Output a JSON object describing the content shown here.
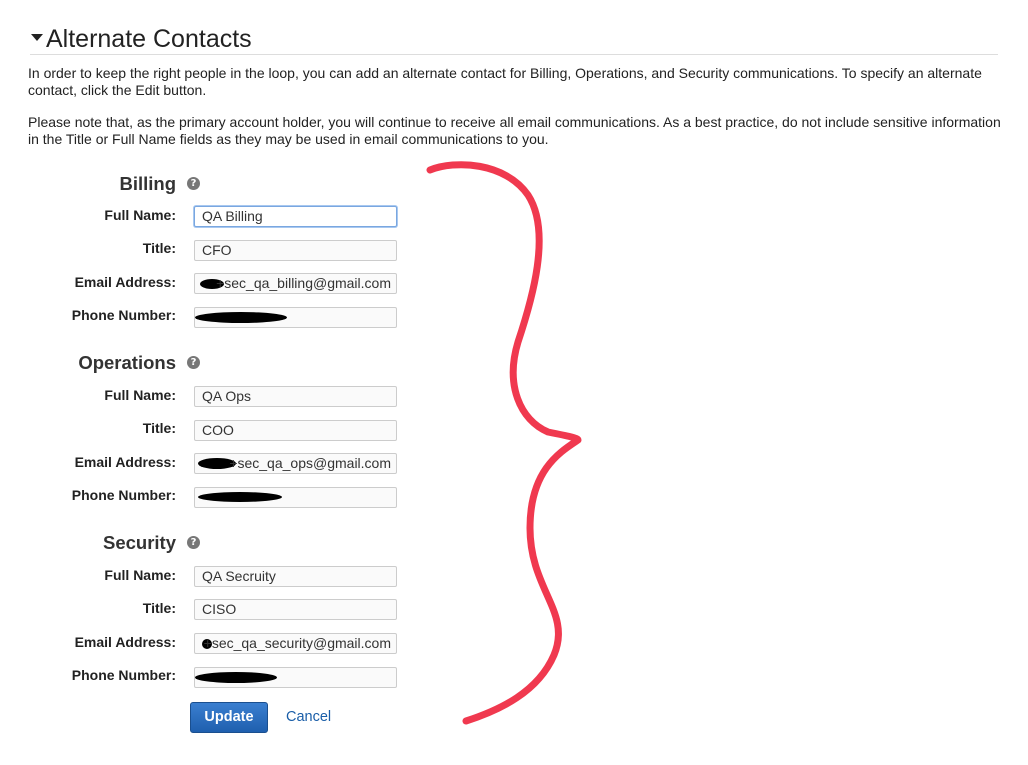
{
  "section": {
    "title": "Alternate Contacts",
    "intro_1": "In order to keep the right people in the loop, you can add an alternate contact for Billing, Operations, and Security communications. To specify an alternate contact, click the Edit button.",
    "intro_2": "Please note that, as the primary account holder, you will continue to receive all email communications. As a best practice, do not include sensitive information in the Title or Full Name fields as they may be used in email communications to you."
  },
  "labels": {
    "full_name": "Full Name:",
    "title": "Title:",
    "email": "Email Address:",
    "phone": "Phone Number:"
  },
  "help_glyph": "?",
  "billing": {
    "heading": "Billing",
    "full_name": "QA Billing",
    "title": "CFO",
    "email": "+sec_qa_billing@gmail.com"
  },
  "operations": {
    "heading": "Operations",
    "full_name": "QA Ops",
    "title": "COO",
    "email": "+sec_qa_ops@gmail.com"
  },
  "security": {
    "heading": "Security",
    "full_name": "QA Secruity",
    "title": "CISO",
    "email": "+sec_qa_security@gmail.com"
  },
  "actions": {
    "update_label": "Update",
    "cancel_label": "Cancel"
  },
  "icons": {
    "caret": "caret-down-icon",
    "help": "help-icon",
    "annotation": "red-curly-brace-annotation"
  },
  "colors": {
    "accent_blue": "#1f5fae",
    "link_blue": "#1a5ea8",
    "annotation_red": "#f0394f",
    "input_focus": "#7aa7e0"
  }
}
